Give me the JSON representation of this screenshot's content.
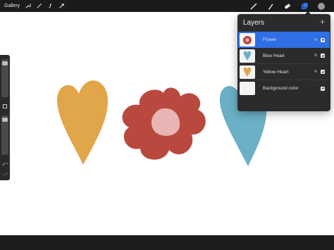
{
  "topbar": {
    "gallery_label": "Gallery",
    "left_tools": [
      "wrench-icon",
      "magic-wand-icon",
      "selection-icon",
      "transform-icon"
    ],
    "right_tools": [
      "brush-icon",
      "smudge-icon",
      "eraser-icon",
      "layers-icon",
      "color-swatch-icon"
    ]
  },
  "layers_panel": {
    "title": "Layers",
    "add_icon": "+",
    "layers": [
      {
        "name": "Flower",
        "blend": "N",
        "visible": true,
        "selected": true
      },
      {
        "name": "Blue Heart",
        "blend": "N",
        "visible": true,
        "selected": false
      },
      {
        "name": "Yellow Heart",
        "blend": "N",
        "visible": true,
        "selected": false
      },
      {
        "name": "Background color",
        "blend": "",
        "visible": true,
        "selected": false
      }
    ]
  },
  "sidebar": {
    "undo_icon": "⤺",
    "redo_icon": "⤻"
  },
  "colors": {
    "yellow_heart": "#e0a649",
    "flower": "#b9493f",
    "flower_center": "#e8b4b4",
    "blue_heart": "#6bb0c6"
  }
}
